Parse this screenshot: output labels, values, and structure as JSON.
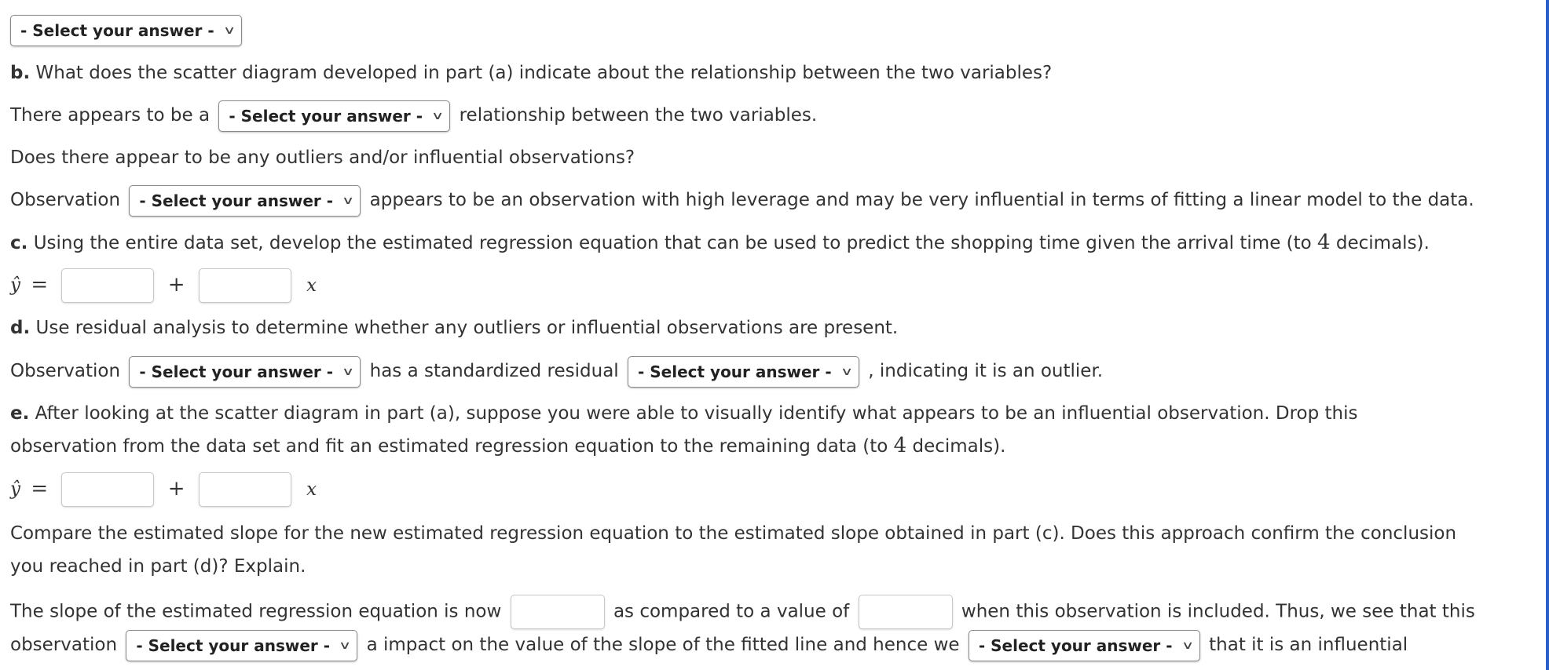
{
  "select_placeholder": "- Select your answer -",
  "part_a": {
    "select": "- Select your answer -"
  },
  "part_b": {
    "label": "b.",
    "question": "What does the scatter diagram developed in part (a) indicate about the relationship between the two variables?",
    "rel_before": "There appears to be a",
    "rel_select": "- Select your answer -",
    "rel_after": "relationship between the two variables.",
    "outlier_q": "Does there appear to be any outliers and/or influential observations?",
    "obs_before": "Observation",
    "obs_select": "- Select your answer -",
    "obs_after": "appears to be an observation with high leverage and may be very influential in terms of fitting a linear model to the data."
  },
  "part_c": {
    "label": "c.",
    "question_before": "Using the entire data set, develop the estimated regression equation that can be used to predict the shopping time given the arrival time (to",
    "decimals": "4",
    "question_after": "decimals).",
    "yhat": "ŷ",
    "equals": "=",
    "plus": "+",
    "x": "x",
    "intercept_value": "",
    "slope_value": ""
  },
  "part_d": {
    "label": "d.",
    "question": "Use residual analysis to determine whether any outliers or influential observations are present.",
    "obs_before": "Observation",
    "obs_select": "- Select your answer -",
    "middle": "has a standardized residual",
    "resid_select": "- Select your answer -",
    "after": ", indicating it is an outlier."
  },
  "part_e": {
    "label": "e.",
    "line1": "After looking at the scatter diagram in part (a), suppose you were able to visually identify what appears to be an influential observation. Drop this",
    "line2_before": "observation from the data set and fit an estimated regression equation to the remaining data (to",
    "decimals": "4",
    "line2_after": "decimals).",
    "yhat": "ŷ",
    "equals": "=",
    "plus": "+",
    "x": "x",
    "intercept_value": "",
    "slope_value": "",
    "compare_line1": "Compare the estimated slope for the new estimated regression equation to the estimated slope obtained in part (c). Does this approach confirm the conclusion",
    "compare_line2": "you reached in part (d)? Explain.",
    "slope_before": "The slope of the estimated regression equation is now",
    "slope_new_value": "",
    "slope_middle": "as compared to a value of",
    "slope_old_value": "",
    "slope_after": "when this observation is included. Thus, we see that this",
    "impact_before": "observation",
    "impact_select": "- Select your answer -",
    "impact_middle": "a impact on the value of the slope of the fitted line and hence we",
    "conclude_select": "- Select your answer -",
    "impact_after": "that it is an influential"
  },
  "colors": {
    "text": "#333333",
    "right_rule": "#2a5fc9"
  }
}
